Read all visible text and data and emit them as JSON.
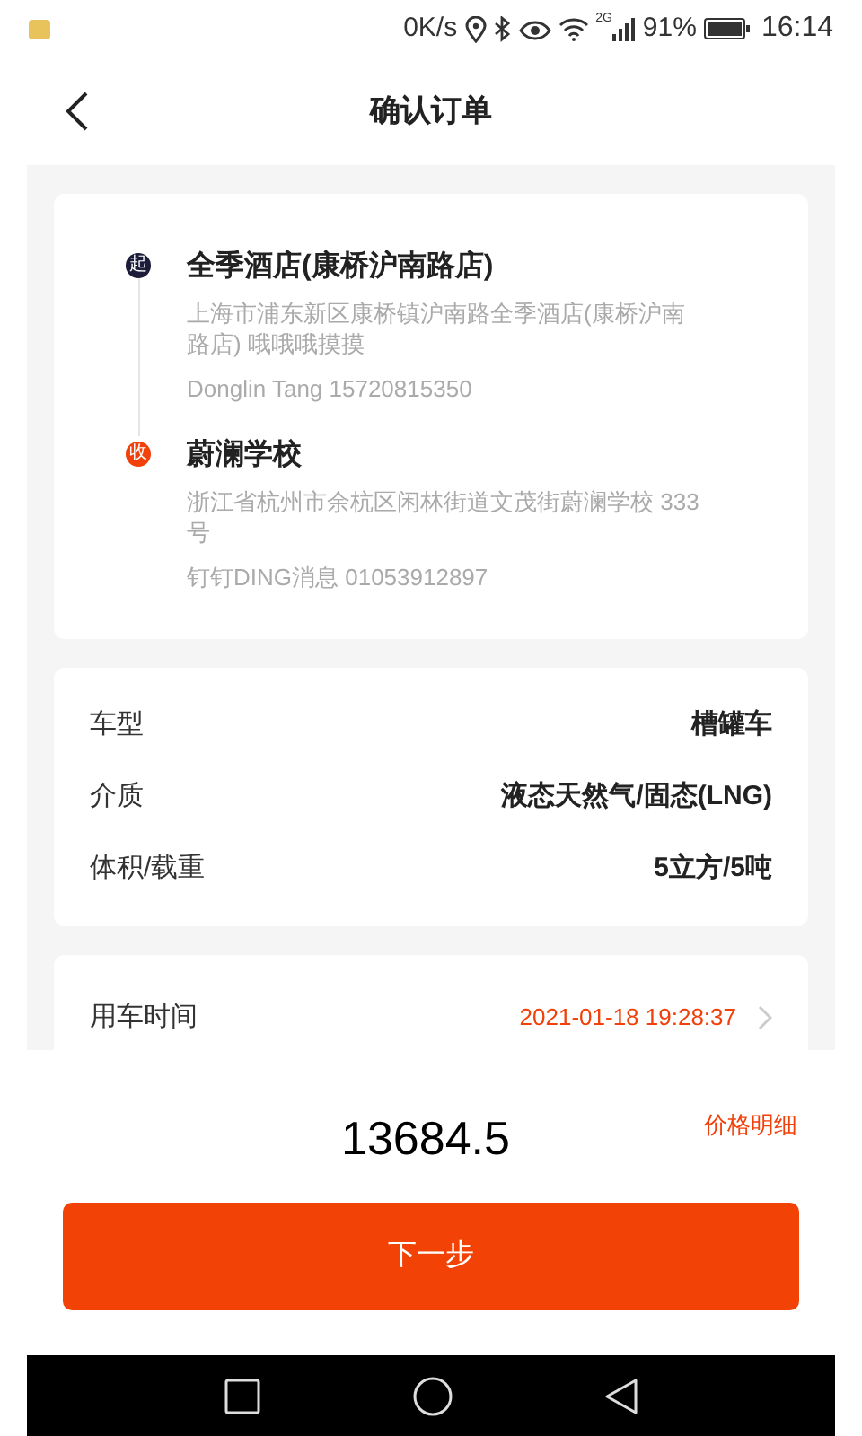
{
  "status_bar": {
    "speed": "0K/s",
    "network": "2G",
    "battery": "91%",
    "time": "16:14"
  },
  "header": {
    "title": "确认订单"
  },
  "route": [
    {
      "kind": "start",
      "badge": "起",
      "name": "全季酒店(康桥沪南路店)",
      "address": "上海市浦东新区康桥镇沪南路全季酒店(康桥沪南路店) 哦哦哦摸摸",
      "contact": "Donglin Tang 15720815350"
    },
    {
      "kind": "end",
      "badge": "收",
      "name": "蔚澜学校",
      "address": "浙江省杭州市余杭区闲林街道文茂街蔚澜学校 333号",
      "contact": "钉钉DING消息 01053912897"
    }
  ],
  "specs": [
    {
      "label": "车型",
      "value": "槽罐车"
    },
    {
      "label": "介质",
      "value": "液态天然气/固态(LNG)"
    },
    {
      "label": "体积/载重",
      "value": "5立方/5吨"
    }
  ],
  "time_row": {
    "label": "用车时间",
    "value": "2021-01-18 19:28:37"
  },
  "footer": {
    "price": "13684.5",
    "detail_link": "价格明细",
    "next_button": "下一步"
  }
}
